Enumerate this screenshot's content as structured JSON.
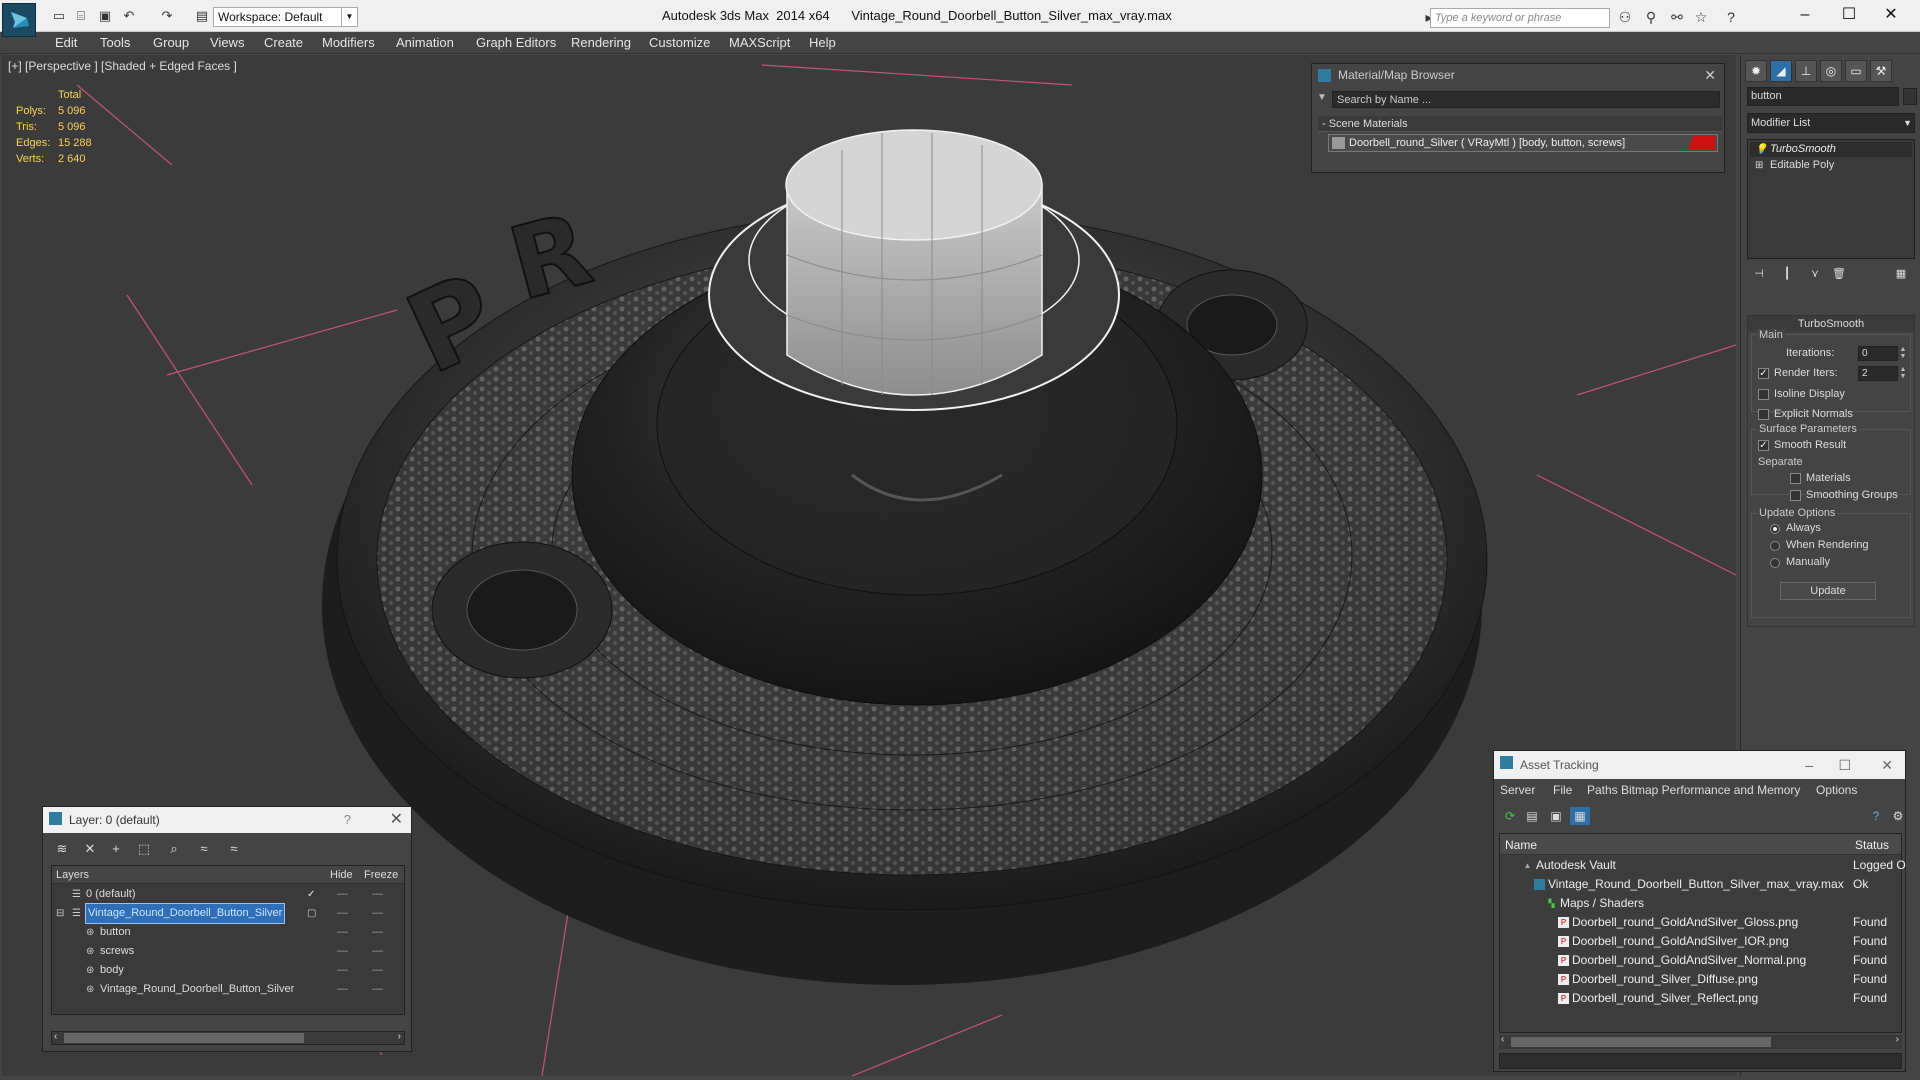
{
  "titlebar": {
    "workspace": "Workspace: Default",
    "title": "Autodesk 3ds Max  2014 x64      Vintage_Round_Doorbell_Button_Silver_max_vray.max",
    "search_placeholder": "Type a keyword or phrase"
  },
  "menu": [
    "Edit",
    "Tools",
    "Group",
    "Views",
    "Create",
    "Modifiers",
    "Animation",
    "Graph Editors",
    "Rendering",
    "Customize",
    "MAXScript",
    "Help"
  ],
  "viewport": {
    "label": "[+] [Perspective ] [Shaded + Edged Faces ]",
    "stats": {
      "total_label": "Total",
      "rows": [
        {
          "k": "Polys:",
          "v": "5 096"
        },
        {
          "k": "Tris:",
          "v": "5 096"
        },
        {
          "k": "Edges:",
          "v": "15 288"
        },
        {
          "k": "Verts:",
          "v": "2 640"
        }
      ]
    }
  },
  "material_browser": {
    "title": "Material/Map Browser",
    "search_placeholder": "Search by Name ...",
    "section": "- Scene Materials",
    "material": "Doorbell_round_Silver  ( VRayMtl ) [body, button, screws]"
  },
  "command_panel": {
    "object_name": "button",
    "modifier_list": "Modifier List",
    "stack": [
      "TurboSmooth",
      "Editable Poly"
    ],
    "turbosmooth": {
      "title": "TurboSmooth",
      "main_label": "Main",
      "iterations_label": "Iterations:",
      "iterations_value": "0",
      "render_iters_label": "Render Iters:",
      "render_iters_value": "2",
      "isoline_label": "Isoline Display",
      "explicit_label": "Explicit Normals",
      "surface_label": "Surface Parameters",
      "smooth_result_label": "Smooth Result",
      "separate_label": "Separate",
      "materials_label": "Materials",
      "smoothing_groups_label": "Smoothing Groups",
      "update_options_label": "Update Options",
      "always_label": "Always",
      "when_rendering_label": "When Rendering",
      "manually_label": "Manually",
      "update_button": "Update"
    }
  },
  "layer_window": {
    "title": "Layer: 0 (default)",
    "help": "?",
    "col_layers": "Layers",
    "col_hide": "Hide",
    "col_freeze": "Freeze",
    "rows": [
      {
        "name": "0 (default)"
      },
      {
        "name": "Vintage_Round_Doorbell_Button_Silver"
      },
      {
        "name": "button"
      },
      {
        "name": "screws"
      },
      {
        "name": "body"
      },
      {
        "name": "Vintage_Round_Doorbell_Button_Silver"
      }
    ]
  },
  "asset_tracking": {
    "title": "Asset Tracking",
    "menu": [
      "Server",
      "File",
      "Paths",
      "Bitmap Performance and Memory",
      "Options"
    ],
    "col_name": "Name",
    "col_status": "Status",
    "rows": [
      {
        "name": "Autodesk Vault",
        "status": "Logged O"
      },
      {
        "name": "Vintage_Round_Doorbell_Button_Silver_max_vray.max",
        "status": "Ok"
      },
      {
        "name": "Maps / Shaders",
        "status": ""
      },
      {
        "name": "Doorbell_round_GoldAndSilver_Gloss.png",
        "status": "Found"
      },
      {
        "name": "Doorbell_round_GoldAndSilver_IOR.png",
        "status": "Found"
      },
      {
        "name": "Doorbell_round_GoldAndSilver_Normal.png",
        "status": "Found"
      },
      {
        "name": "Doorbell_round_Silver_Diffuse.png",
        "status": "Found"
      },
      {
        "name": "Doorbell_round_Silver_Reflect.png",
        "status": "Found"
      }
    ]
  },
  "colors": {
    "accent": "#2e6fb8",
    "stats_text": "#f6d15c",
    "viewport_bg": "#3b3b3b"
  }
}
